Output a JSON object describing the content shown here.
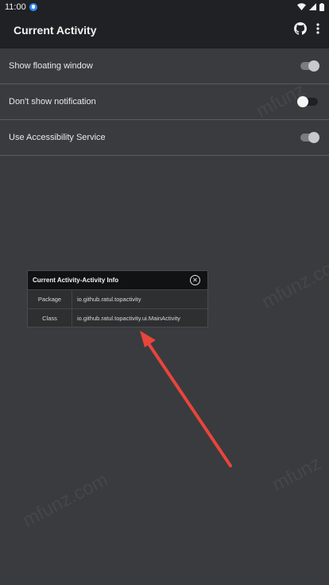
{
  "status_bar": {
    "time": "11:00",
    "icons": [
      "download-indicator-icon",
      "wifi-icon",
      "cell-signal-icon",
      "battery-icon"
    ]
  },
  "app_bar": {
    "title": "Current Activity",
    "icons": [
      "github-icon",
      "more-vert-icon"
    ]
  },
  "settings": [
    {
      "label": "Show floating window",
      "state": "on"
    },
    {
      "label": "Don't show notification",
      "state": "off"
    },
    {
      "label": "Use Accessibility Service",
      "state": "on"
    }
  ],
  "floating_window": {
    "title": "Current Activity-Activity Info",
    "rows": [
      {
        "key": "Package",
        "value": "io.github.ratul.topactivity"
      },
      {
        "key": "Class",
        "value": "io.github.ratul.topactivity.ui.MainActivity"
      }
    ]
  },
  "watermark": {
    "text": "mfunz.com",
    "text_fragment_1": "mfunz",
    "text_fragment_2": "mfunz.co"
  },
  "colors": {
    "app_bar": "#202124",
    "background": "#3a3b3e",
    "annotation_arrow": "#e8453c"
  }
}
